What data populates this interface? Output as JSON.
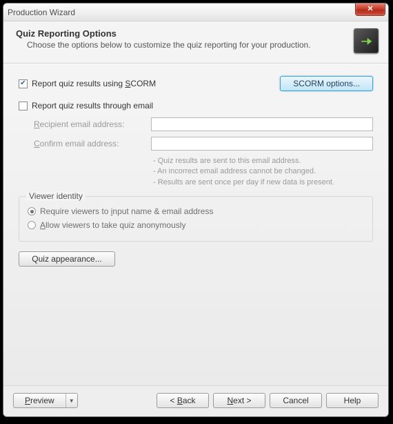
{
  "window": {
    "title": "Production Wizard"
  },
  "header": {
    "title": "Quiz Reporting Options",
    "subtitle": "Choose the options below to customize the quiz reporting for your production."
  },
  "scorm_check": {
    "label_pre": "Report quiz results using ",
    "label_u": "S",
    "label_post": "CORM",
    "checked": true
  },
  "scorm_button": "SCORM options...",
  "email_check": {
    "label": "Report quiz results through email",
    "checked": false
  },
  "recipient": {
    "label_u": "R",
    "label_post": "ecipient email address:",
    "value": ""
  },
  "confirm": {
    "label_u": "C",
    "label_post": "onfirm email address:",
    "value": ""
  },
  "hints": [
    "Quiz results are sent to this email address.",
    "An incorrect email address cannot be changed.",
    "Results are sent once per day if new data is present."
  ],
  "viewer": {
    "legend": "Viewer identity",
    "require": {
      "pre": "Require viewers to ",
      "u": "i",
      "post": "nput name & email address"
    },
    "anon": {
      "pre": "",
      "u": "A",
      "post": "llow viewers to take quiz anonymously"
    },
    "selected": "require"
  },
  "quiz_appearance_btn": "Quiz appearance...",
  "footer": {
    "preview": {
      "u": "P",
      "post": "review"
    },
    "back": {
      "pre": "< ",
      "u": "B",
      "post": "ack"
    },
    "next": {
      "u": "N",
      "post": "ext >"
    },
    "cancel": "Cancel",
    "help": "Help"
  }
}
